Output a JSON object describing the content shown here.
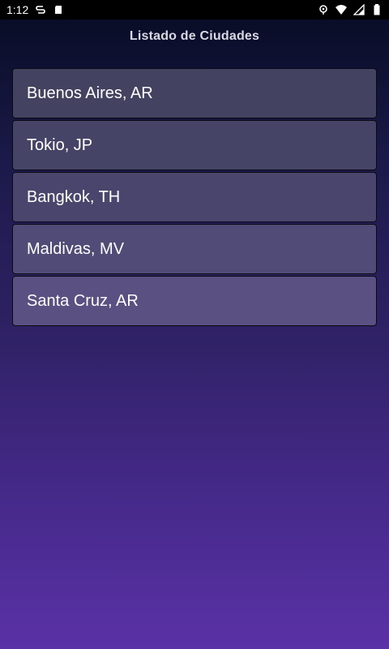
{
  "status_bar": {
    "time": "1:12",
    "icons": [
      "sync-icon",
      "sd-card-icon",
      "location-icon",
      "wifi-icon",
      "signal-icon",
      "battery-icon"
    ]
  },
  "header": {
    "title": "Listado de Ciudades"
  },
  "cities": [
    {
      "label": "Buenos Aires, AR"
    },
    {
      "label": "Tokio, JP"
    },
    {
      "label": "Bangkok, TH"
    },
    {
      "label": "Maldivas, MV"
    },
    {
      "label": "Santa Cruz, AR"
    }
  ],
  "colors": {
    "status_bar_bg": "#000000",
    "gradient_top": "#070b22",
    "gradient_bottom": "#5a31a6",
    "title_text": "#d8d8e6",
    "item_text": "#ffffff"
  }
}
